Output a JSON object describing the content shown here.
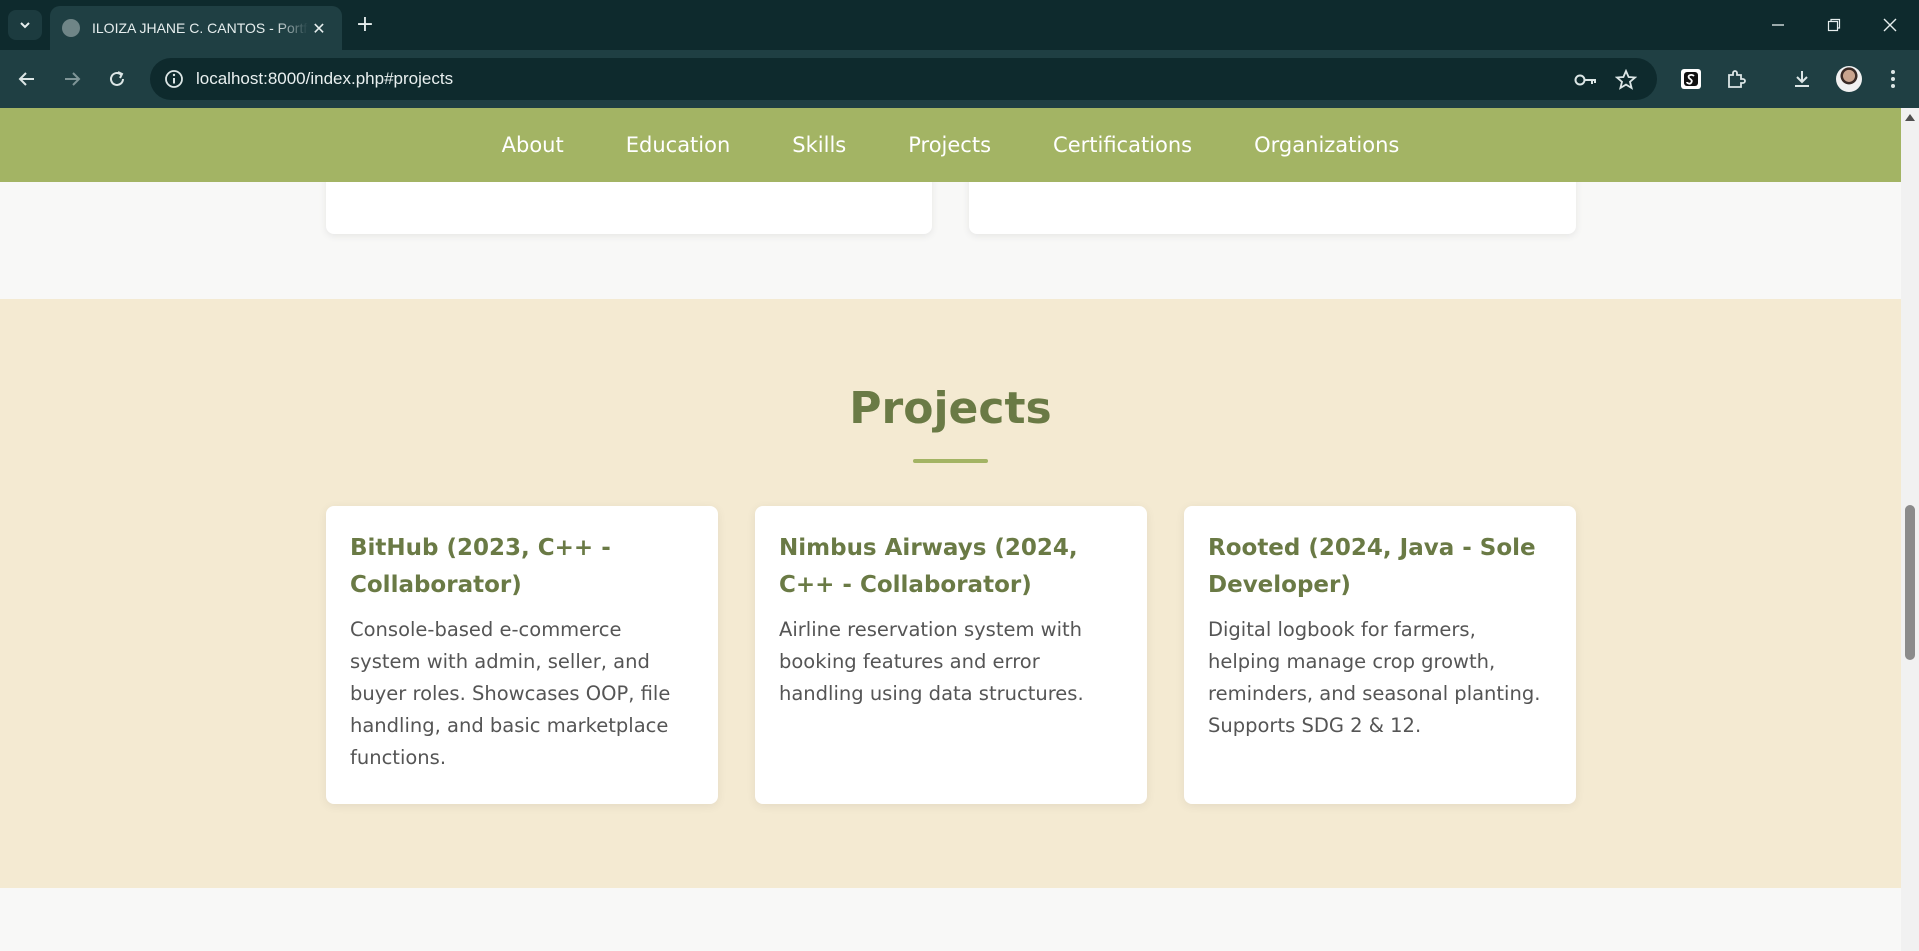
{
  "browser": {
    "tab_title": "ILOIZA JHANE C. CANTOS - Portfolio",
    "url": "localhost:8000/index.php#projects"
  },
  "nav": {
    "items": [
      "About",
      "Education",
      "Skills",
      "Projects",
      "Certifications",
      "Organizations"
    ]
  },
  "projects": {
    "heading": "Projects",
    "cards": [
      {
        "title": "BitHub (2023, C++ - Collaborator)",
        "description": "Console-based e-commerce system with admin, seller, and buyer roles. Showcases OOP, file handling, and basic marketplace functions."
      },
      {
        "title": "Nimbus Airways (2024, C++ - Collaborator)",
        "description": "Airline reservation system with booking features and error handling using data structures."
      },
      {
        "title": "Rooted (2024, Java - Sole Developer)",
        "description": "Digital logbook for farmers, helping manage crop growth, reminders, and seasonal planting. Supports SDG 2 & 12."
      }
    ]
  },
  "colors": {
    "nav_bg": "#a3b464",
    "accent": "#6a7a45",
    "section_bg": "#f4ead2"
  }
}
